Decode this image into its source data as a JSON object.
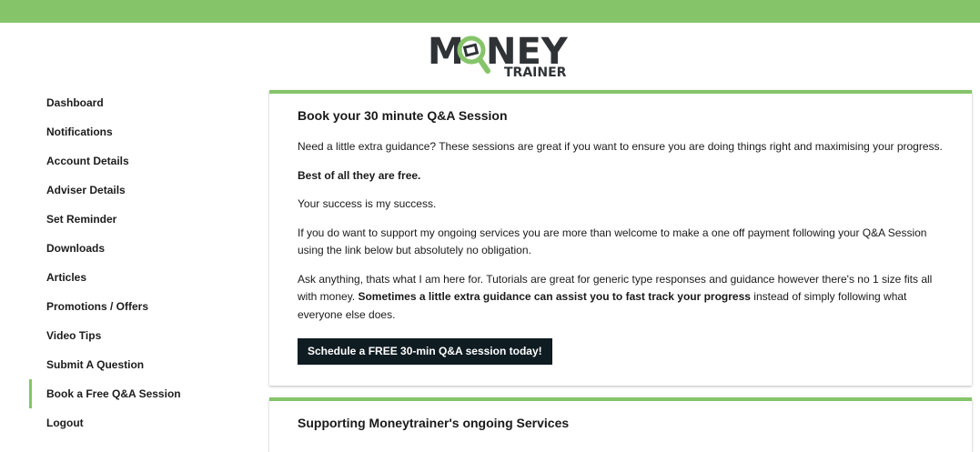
{
  "brand": {
    "logo_word": "MONEY",
    "logo_sub": "TRAINER",
    "accent_color": "#86c46a",
    "dark_color": "#2f3336"
  },
  "sidebar": {
    "active_index": 10,
    "items": [
      {
        "label": "Dashboard"
      },
      {
        "label": "Notifications"
      },
      {
        "label": "Account Details"
      },
      {
        "label": "Adviser Details"
      },
      {
        "label": "Set Reminder"
      },
      {
        "label": "Downloads"
      },
      {
        "label": "Articles"
      },
      {
        "label": "Promotions / Offers"
      },
      {
        "label": "Video Tips"
      },
      {
        "label": "Submit A Question"
      },
      {
        "label": "Book a Free Q&A Session"
      },
      {
        "label": "Logout"
      }
    ]
  },
  "session_card": {
    "title": "Book your 30 minute Q&A Session",
    "intro": "Need a little extra guidance? These sessions are great if you want to ensure you are doing things right and maximising your progress.",
    "free_note": "Best of all they are free.",
    "success": "Your success is my success.",
    "support": "If you do want to support my ongoing services you are more than welcome to make a one off payment following your Q&A Session using the link below but absolutely no obligation.",
    "ask_start": "Ask anything, thats what I am here for. Tutorials are great for generic type responses and guidance however there's no 1 size fits all with money. ",
    "ask_bold": "Sometimes a little extra guidance can assist you to fast track your progress",
    "ask_end": " instead of simply following what everyone else does.",
    "button_label": "Schedule a FREE 30-min Q&A session today!"
  },
  "support_card": {
    "title": "Supporting Moneytrainer's ongoing Services"
  }
}
